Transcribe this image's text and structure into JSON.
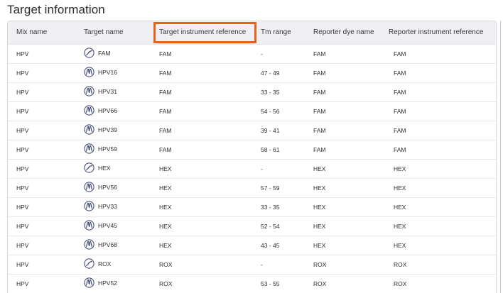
{
  "page": {
    "title": "Target information"
  },
  "table": {
    "columns": [
      "Mix name",
      "Target name",
      "Target instrument reference",
      "Tm range",
      "Reporter dye name",
      "Reporter instrument reference"
    ],
    "rows": [
      {
        "mix": "HPV",
        "target": "FAM",
        "icon": "sigmoid-curve-icon",
        "target_ref": "FAM",
        "tm": "-",
        "dye": "FAM",
        "reporter_ref": "FAM"
      },
      {
        "mix": "HPV",
        "target": "HPV16",
        "icon": "melt-peak-icon",
        "target_ref": "FAM",
        "tm": "47 - 49",
        "dye": "FAM",
        "reporter_ref": "FAM"
      },
      {
        "mix": "HPV",
        "target": "HPV31",
        "icon": "melt-peak-icon",
        "target_ref": "FAM",
        "tm": "33 - 35",
        "dye": "FAM",
        "reporter_ref": "FAM"
      },
      {
        "mix": "HPV",
        "target": "HPV66",
        "icon": "melt-peak-icon",
        "target_ref": "FAM",
        "tm": "54 - 56",
        "dye": "FAM",
        "reporter_ref": "FAM"
      },
      {
        "mix": "HPV",
        "target": "HPV39",
        "icon": "melt-peak-icon",
        "target_ref": "FAM",
        "tm": "39 - 41",
        "dye": "FAM",
        "reporter_ref": "FAM"
      },
      {
        "mix": "HPV",
        "target": "HPV59",
        "icon": "melt-peak-icon",
        "target_ref": "FAM",
        "tm": "58 - 61",
        "dye": "FAM",
        "reporter_ref": "FAM"
      },
      {
        "mix": "HPV",
        "target": "HEX",
        "icon": "sigmoid-curve-icon",
        "target_ref": "HEX",
        "tm": "-",
        "dye": "HEX",
        "reporter_ref": "HEX"
      },
      {
        "mix": "HPV",
        "target": "HPV56",
        "icon": "melt-peak-icon",
        "target_ref": "HEX",
        "tm": "57 - 59",
        "dye": "HEX",
        "reporter_ref": "HEX"
      },
      {
        "mix": "HPV",
        "target": "HPV33",
        "icon": "melt-peak-icon",
        "target_ref": "HEX",
        "tm": "33 - 35",
        "dye": "HEX",
        "reporter_ref": "HEX"
      },
      {
        "mix": "HPV",
        "target": "HPV45",
        "icon": "melt-peak-icon",
        "target_ref": "HEX",
        "tm": "52 - 54",
        "dye": "HEX",
        "reporter_ref": "HEX"
      },
      {
        "mix": "HPV",
        "target": "HPV68",
        "icon": "melt-peak-icon",
        "target_ref": "HEX",
        "tm": "43 - 45",
        "dye": "HEX",
        "reporter_ref": "HEX"
      },
      {
        "mix": "HPV",
        "target": "ROX",
        "icon": "sigmoid-curve-icon",
        "target_ref": "ROX",
        "tm": "-",
        "dye": "ROX",
        "reporter_ref": "ROX"
      },
      {
        "mix": "HPV",
        "target": "HPV52",
        "icon": "melt-peak-icon",
        "target_ref": "ROX",
        "tm": "53 - 55",
        "dye": "ROX",
        "reporter_ref": "ROX"
      }
    ]
  },
  "highlight": {
    "column_index": 2,
    "color": "#e8621c"
  },
  "colors": {
    "header_bg": "#eef0f3",
    "border": "#d9dde3",
    "icon_stroke": "#33406a"
  }
}
